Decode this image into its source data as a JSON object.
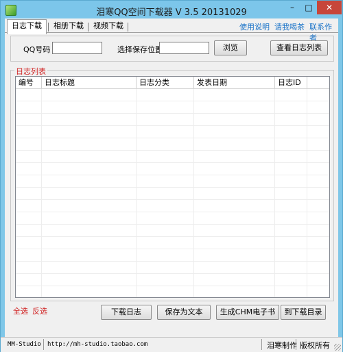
{
  "window": {
    "title": "泪寒QQ空间下载器 V 3.5 20131029",
    "minimize": "–",
    "maximize": "□",
    "close": "✕"
  },
  "tabs": [
    {
      "label": "日志下载"
    },
    {
      "label": "相册下载"
    },
    {
      "label": "视频下载"
    }
  ],
  "top_links": {
    "help": "使用说明",
    "tea": "请我喝茶",
    "contact": "联系作者"
  },
  "form": {
    "qq_label": "QQ号码",
    "qq_value": "",
    "save_label": "选择保存位置",
    "save_value": "",
    "browse_button": "浏览",
    "view_list_button": "查看日志列表"
  },
  "log_group": {
    "title": "日志列表",
    "columns": [
      "编号",
      "日志标题",
      "日志分类",
      "发表日期",
      "日志ID"
    ],
    "rows": []
  },
  "actions": {
    "select_all": "全选",
    "invert": "反选",
    "download": "下载日志",
    "save_text": "保存为文本",
    "gen_chm": "生成CHM电子书",
    "open_dir": "到下载目录"
  },
  "status": {
    "studio": "MM-Studio",
    "url": "http://mh-studio.taobao.com",
    "made_by": "泪寒制作",
    "rights": "版权所有"
  },
  "colors": {
    "titlebar": "#7cc6ea",
    "close": "#c7463a",
    "link": "#1a73c8",
    "red_text": "#d02020"
  }
}
